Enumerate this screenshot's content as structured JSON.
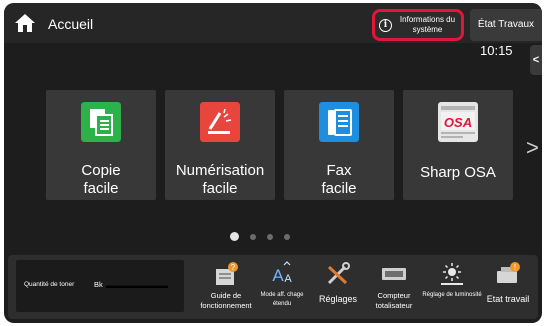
{
  "header": {
    "home_label": "Accueil",
    "system_info_label": "Informations du système",
    "job_status_label": "État Travaux",
    "time": "10:15",
    "side_tab_glyph": "<"
  },
  "apps": [
    {
      "line1": "Copie",
      "line2": "facile",
      "icon": "copy-icon",
      "color": "#2db14b"
    },
    {
      "line1": "Numérisation",
      "line2": "facile",
      "icon": "scan-icon",
      "color": "#e8453c"
    },
    {
      "line1": "Fax",
      "line2": "facile",
      "icon": "fax-icon",
      "color": "#1e8fe0"
    },
    {
      "line1": "Sharp OSA",
      "line2": "",
      "icon": "sharp-osa-icon",
      "color": "#d9d9d9"
    }
  ],
  "pager": {
    "total": 4,
    "active": 0,
    "next_glyph": ">"
  },
  "toner": {
    "label": "Quantité de toner",
    "color_label": "Bk"
  },
  "quick_actions": [
    {
      "label": "Guide de fonctionnement",
      "icon": "operation-guide-icon"
    },
    {
      "label": "Mode aff. chage étendu",
      "icon": "enlarged-display-icon"
    },
    {
      "label": "Réglages",
      "icon": "settings-tools-icon"
    },
    {
      "label": "Compteur totalisateur",
      "icon": "total-counter-icon"
    },
    {
      "label": "Réglage de luminosité",
      "icon": "brightness-icon"
    },
    {
      "label": "Etat travail",
      "icon": "job-status-icon"
    }
  ],
  "colors": {
    "highlight": "#e0163b",
    "background": "#1d1d1d",
    "tile": "#383838"
  }
}
